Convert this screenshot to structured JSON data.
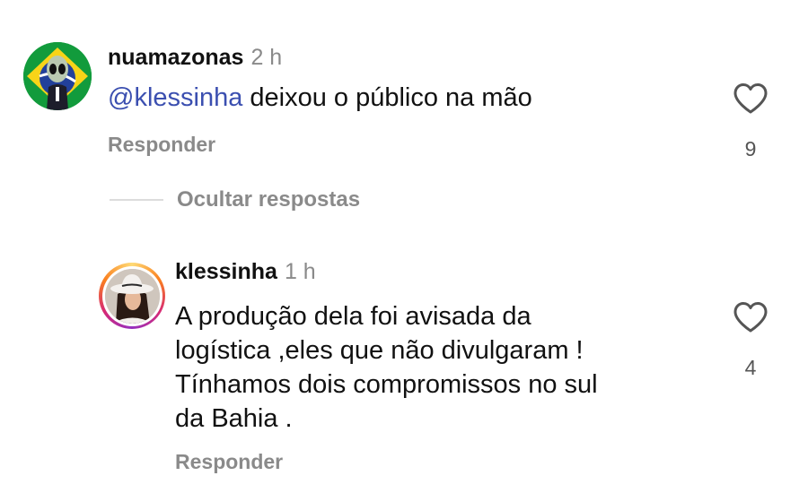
{
  "comments": [
    {
      "username": "nuamazonas",
      "time": "2 h",
      "mention": "@klessinha",
      "text": " deixou o público na mão",
      "reply_label": "Responder",
      "likes": "9",
      "avatar_icon": "alien-flag-avatar"
    }
  ],
  "hide_replies_label": "Ocultar respostas",
  "replies": [
    {
      "username": "klessinha",
      "time": "1 h",
      "lines": [
        "A produção dela foi avisada da",
        "logística ,eles que não divulgaram !",
        "Tínhamos dois compromissos no sul",
        "da Bahia ."
      ],
      "reply_label": "Responder",
      "likes": "4",
      "avatar_icon": "woman-cowboy-hat-avatar",
      "has_story_ring": true
    }
  ],
  "colors": {
    "mention": "#3b4fb0",
    "muted": "#8a8a8a",
    "text": "#111111"
  }
}
